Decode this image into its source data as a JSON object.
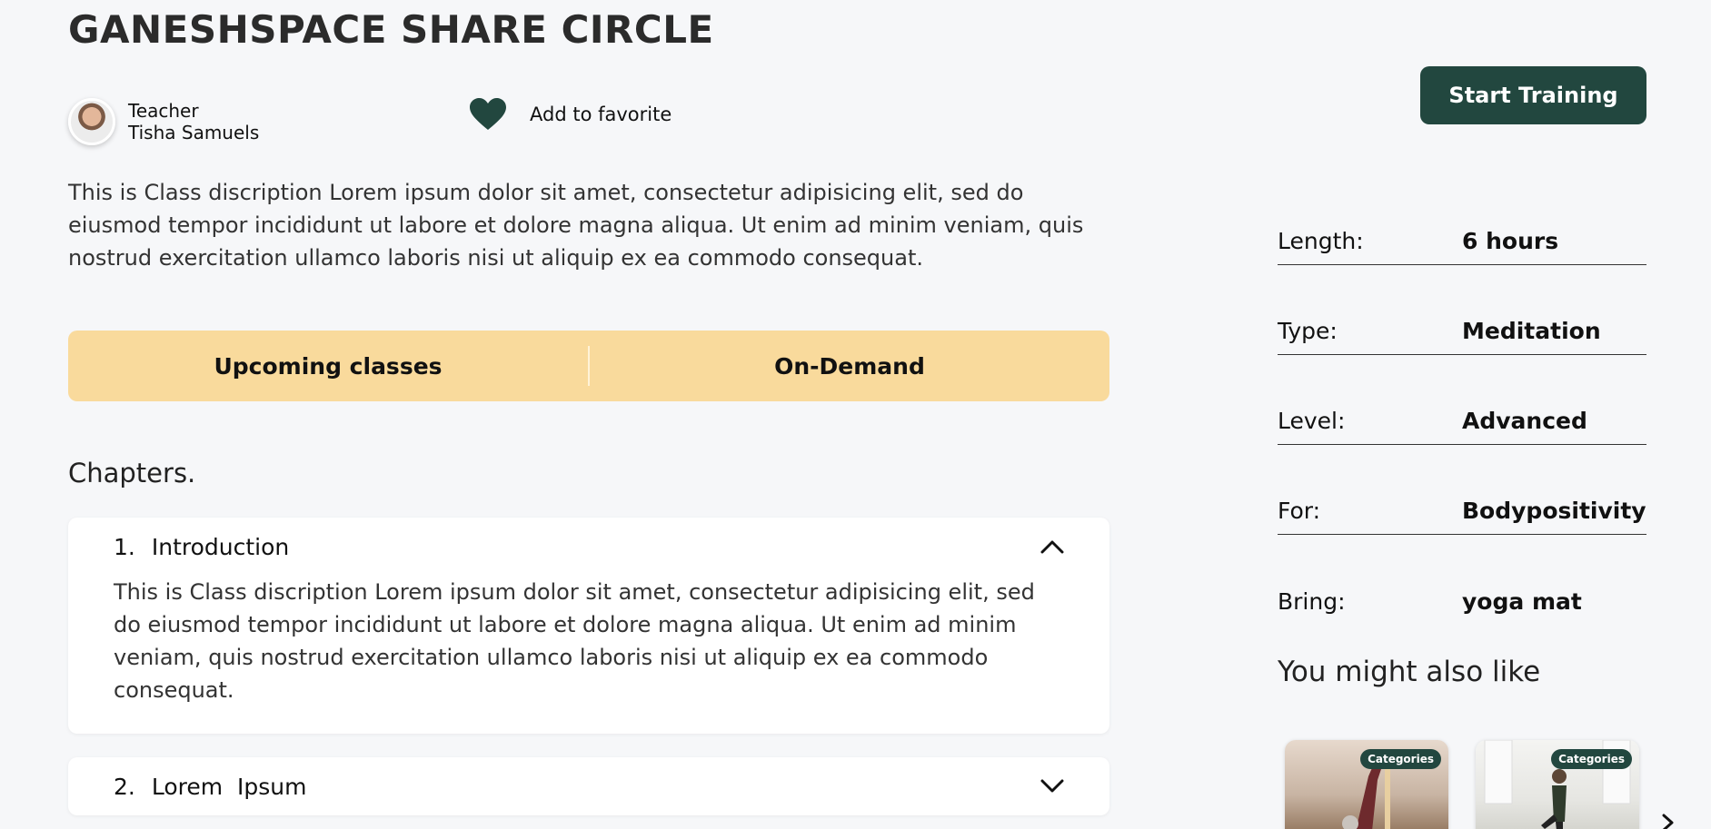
{
  "page": {
    "title": "GANESHSPACE SHARE CIRCLE",
    "start_button": "Start Training",
    "description": "This is Class discription Lorem ipsum dolor sit amet, consectetur adipisicing elit, sed do eiusmod tempor incididunt ut labore et dolore magna aliqua. Ut enim ad minim veniam, quis nostrud exercitation ullamco laboris nisi ut aliquip ex ea commodo consequat."
  },
  "teacher": {
    "role": "Teacher",
    "name": "Tisha Samuels"
  },
  "favorite": {
    "label": "Add to favorite",
    "icon": "heart-icon",
    "color": "#22473f"
  },
  "tabs": [
    {
      "label": "Upcoming classes"
    },
    {
      "label": "On-Demand"
    }
  ],
  "chapters": {
    "heading": "Chapters.",
    "items": [
      {
        "number": "1.",
        "title": "Introduction",
        "expanded": true,
        "body": "This is Class discription Lorem ipsum dolor sit amet, consectetur adipisicing elit, sed do eiusmod tempor incididunt ut labore et dolore magna aliqua. Ut enim ad minim veniam, quis nostrud exercitation ullamco laboris nisi ut aliquip ex ea commodo consequat."
      },
      {
        "number": "2.",
        "title": "Lorem  Ipsum",
        "expanded": false
      }
    ]
  },
  "details": [
    {
      "label": "Length:",
      "value": "6 hours"
    },
    {
      "label": "Type:",
      "value": "Meditation"
    },
    {
      "label": "Level:",
      "value": "Advanced"
    },
    {
      "label": "For:",
      "value": "Bodypositivity"
    },
    {
      "label": "Bring:",
      "value": "yoga mat"
    }
  ],
  "recommendations": {
    "heading": "You might also like",
    "cards": [
      {
        "badge": "Categories"
      },
      {
        "badge": "Categories"
      }
    ]
  },
  "colors": {
    "accent": "#22473f",
    "tabs_bg": "#f9da9c",
    "page_bg": "#f6f7f9"
  }
}
